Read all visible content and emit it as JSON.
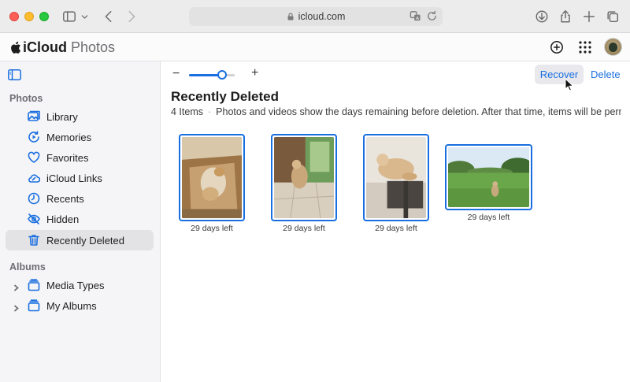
{
  "browser": {
    "url": "icloud.com"
  },
  "header": {
    "brand_main": "iCloud",
    "brand_product": "Photos"
  },
  "sidebar": {
    "photos_section": "Photos",
    "items": [
      {
        "label": "Library",
        "icon": "library-icon"
      },
      {
        "label": "Memories",
        "icon": "memories-icon"
      },
      {
        "label": "Favorites",
        "icon": "heart-icon"
      },
      {
        "label": "iCloud Links",
        "icon": "cloud-link-icon"
      },
      {
        "label": "Recents",
        "icon": "clock-icon"
      },
      {
        "label": "Hidden",
        "icon": "eye-slash-icon"
      },
      {
        "label": "Recently Deleted",
        "icon": "trash-icon",
        "selected": true
      }
    ],
    "albums_section": "Albums",
    "albums": [
      {
        "label": "Media Types",
        "icon": "album-stack-icon"
      },
      {
        "label": "My Albums",
        "icon": "album-stack-icon"
      }
    ]
  },
  "toolbar": {
    "zoom_minus": "−",
    "zoom_plus": "+",
    "zoom_level": 0.72,
    "recover_label": "Recover",
    "delete_label": "Delete"
  },
  "main": {
    "title": "Recently Deleted",
    "item_count": "4 Items",
    "description": "Photos and videos show the days remaining before deletion. After that time, items will be perma..."
  },
  "photos": [
    {
      "caption": "29 days left",
      "selected": true
    },
    {
      "caption": "29 days left",
      "selected": true
    },
    {
      "caption": "29 days left",
      "selected": true
    },
    {
      "caption": "29 days left",
      "selected": true
    }
  ],
  "colors": {
    "accent": "#1a6fe0",
    "sidebar_bg": "#f5f5f7",
    "selected_row": "#e3e3e6"
  }
}
